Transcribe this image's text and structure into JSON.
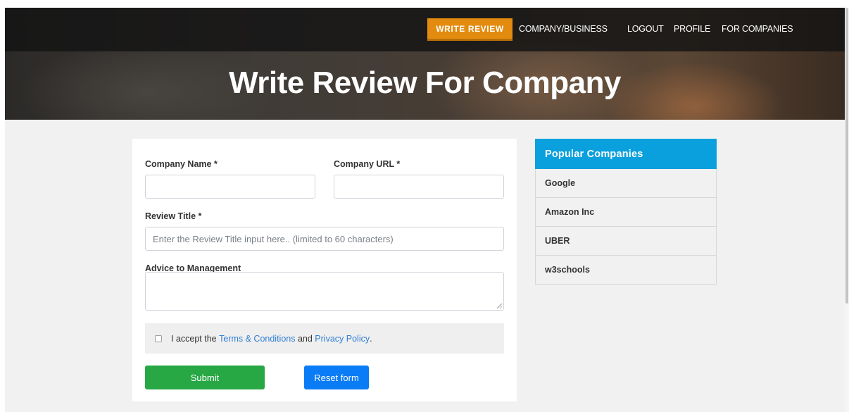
{
  "nav": {
    "write_review": "WRITE REVIEW",
    "links": [
      "COMPANY/BUSINESS",
      "LOGOUT",
      "PROFILE",
      "FOR COMPANIES"
    ]
  },
  "hero": {
    "title": "Write Review For Company"
  },
  "form": {
    "company_name_label": "Company Name *",
    "company_name_value": "",
    "company_url_label": "Company URL *",
    "company_url_value": "",
    "review_title_label": "Review Title *",
    "review_title_placeholder": "Enter the Review Title input here.. (limited to 60 characters)",
    "advice_label": "Advice to Management",
    "terms": {
      "prefix": "I accept the ",
      "terms_link": "Terms & Conditions",
      "middle": " and ",
      "privacy_link": "Privacy Policy",
      "suffix": "."
    },
    "submit_label": "Submit",
    "reset_label": "Reset form"
  },
  "popular": {
    "title": "Popular Companies",
    "items": [
      "Google",
      "Amazon Inc",
      "UBER",
      "w3schools"
    ]
  },
  "colors": {
    "write_review_bg": "#e38b0f",
    "submit_bg": "#28a745",
    "reset_bg": "#0a7cf5",
    "popular_header_bg": "#0aa0dd",
    "link": "#2f7fd4"
  }
}
